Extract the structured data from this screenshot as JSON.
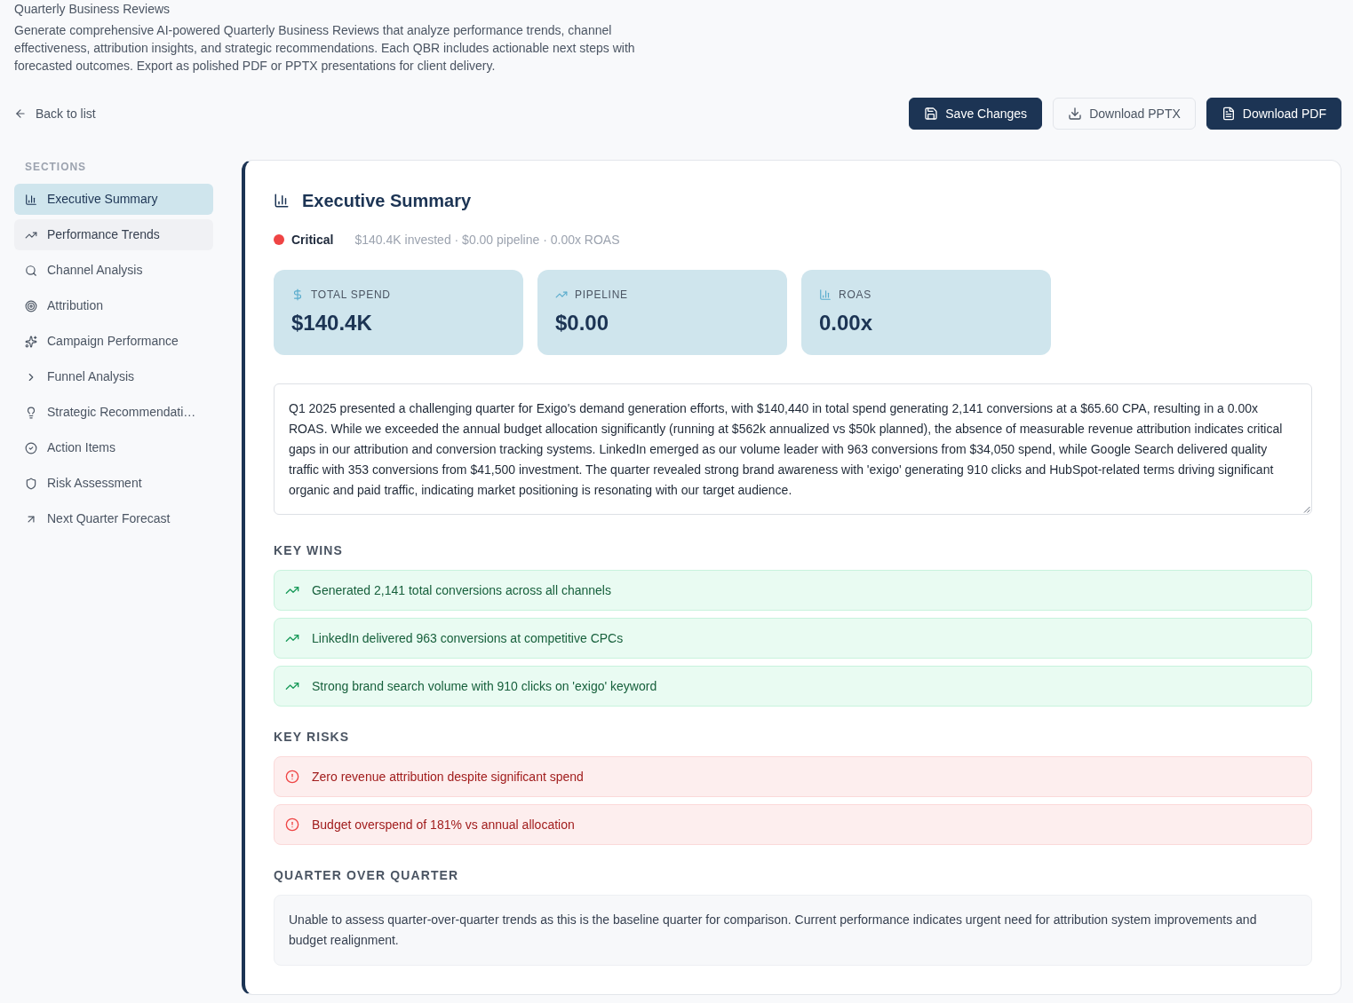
{
  "page": {
    "title": "Quarterly Business Reviews",
    "description": "Generate comprehensive AI-powered Quarterly Business Reviews that analyze performance trends, channel effectiveness, attribution insights, and strategic recommendations. Each QBR includes actionable next steps with forecasted outcomes. Export as polished PDF or PPTX presentations for client delivery."
  },
  "toolbar": {
    "back_link": "Back to list",
    "buttons": [
      {
        "label": "Save Changes",
        "kind": "primary"
      },
      {
        "label": "Download PPTX",
        "kind": "secondary"
      },
      {
        "label": "Download PDF",
        "kind": "primary"
      }
    ]
  },
  "sidebar": {
    "heading": "SECTIONS",
    "items": [
      {
        "label": "Executive Summary",
        "selected": true,
        "hovered": false
      },
      {
        "label": "Performance Trends",
        "selected": false,
        "hovered": true
      },
      {
        "label": "Channel Analysis",
        "selected": false,
        "hovered": false
      },
      {
        "label": "Attribution",
        "selected": false,
        "hovered": false
      },
      {
        "label": "Campaign Performance",
        "selected": false,
        "hovered": false
      },
      {
        "label": "Funnel Analysis",
        "selected": false,
        "hovered": false
      },
      {
        "label": "Strategic Recommendati…",
        "selected": false,
        "hovered": false
      },
      {
        "label": "Action Items",
        "selected": false,
        "hovered": false
      },
      {
        "label": "Risk Assessment",
        "selected": false,
        "hovered": false
      },
      {
        "label": "Next Quarter Forecast",
        "selected": false,
        "hovered": false
      }
    ]
  },
  "section": {
    "title": "Executive Summary",
    "status": {
      "label": "Critical",
      "color": "#ef4444"
    },
    "meta": "$140.4K invested · $0.00 pipeline · 0.00x ROAS",
    "metrics": [
      {
        "label": "TOTAL SPEND",
        "value": "$140.4K"
      },
      {
        "label": "PIPELINE",
        "value": "$0.00"
      },
      {
        "label": "ROAS",
        "value": "0.00x"
      }
    ],
    "summary": "Q1 2025 presented a challenging quarter for Exigo's demand generation efforts, with $140,440 in total spend generating 2,141 conversions at a $65.60 CPA, resulting in a 0.00x ROAS. While we exceeded the annual budget allocation significantly (running at $562k annualized vs $50k planned), the absence of measurable revenue attribution indicates critical gaps in our attribution and conversion tracking systems. LinkedIn emerged as our volume leader with 963 conversions from $34,050 spend, while Google Search delivered quality traffic with 353 conversions from $41,500 investment. The quarter revealed strong brand awareness with 'exigo' generating 910 clicks and HubSpot-related terms driving significant organic and paid traffic, indicating market positioning is resonating with our target audience.",
    "key_wins": {
      "heading": "KEY WINS",
      "items": [
        "Generated 2,141 total conversions across all channels",
        "LinkedIn delivered 963 conversions at competitive CPCs",
        "Strong brand search volume with 910 clicks on 'exigo' keyword"
      ]
    },
    "key_risks": {
      "heading": "KEY RISKS",
      "items": [
        "Zero revenue attribution despite significant spend",
        "Budget overspend of 181% vs annual allocation"
      ]
    },
    "quarter_over_quarter": {
      "heading": "QUARTER OVER QUARTER",
      "text": "Unable to assess quarter-over-quarter trends as this is the baseline quarter for comparison. Current performance indicates urgent need for attribution system improvements and budget realignment."
    }
  }
}
